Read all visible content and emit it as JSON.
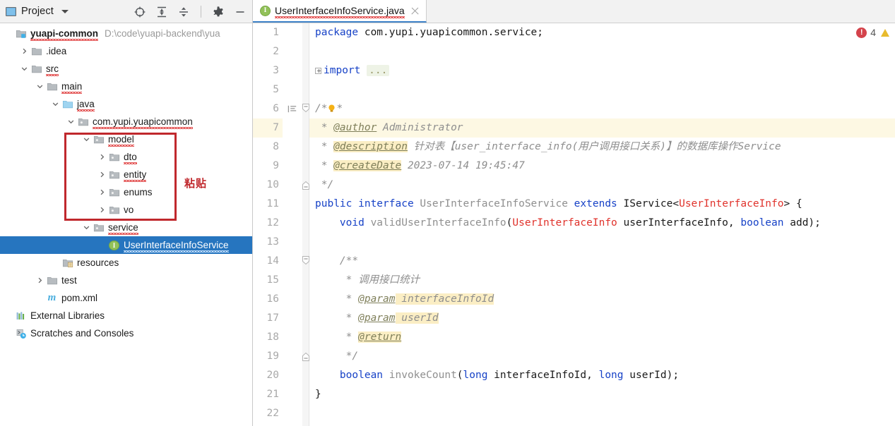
{
  "window": {
    "app": "IntelliJ IDEA"
  },
  "sidebar": {
    "toolbar": {
      "title": "Project",
      "dropdown_icon": "chevron-down-icon",
      "buttons": [
        {
          "name": "select-opened-file-icon",
          "tooltip": "Select Opened File"
        },
        {
          "name": "expand-all-icon",
          "tooltip": "Expand All"
        },
        {
          "name": "collapse-all-icon",
          "tooltip": "Collapse All"
        },
        {
          "name": "settings-gear-icon",
          "tooltip": "Settings"
        },
        {
          "name": "hide-icon",
          "tooltip": "Hide"
        }
      ]
    },
    "tree": [
      {
        "label": "yuapi-common",
        "path": "D:\\code\\yuapi-backend\\yua",
        "icon": "module-folder-icon",
        "indent": 0,
        "arrow": "none",
        "bold": true,
        "spell": true
      },
      {
        "label": ".idea",
        "path": "",
        "icon": "folder-icon",
        "indent": 1,
        "arrow": "collapsed",
        "bold": false,
        "spell": false
      },
      {
        "label": "src",
        "path": "",
        "icon": "folder-icon",
        "indent": 1,
        "arrow": "expanded",
        "bold": false,
        "spell": true
      },
      {
        "label": "main",
        "path": "",
        "icon": "folder-icon",
        "indent": 2,
        "arrow": "expanded",
        "bold": false,
        "spell": true
      },
      {
        "label": "java",
        "path": "",
        "icon": "source-root-folder-icon",
        "indent": 3,
        "arrow": "expanded",
        "bold": false,
        "spell": true
      },
      {
        "label": "com.yupi.yuapicommon",
        "path": "",
        "icon": "package-icon",
        "indent": 4,
        "arrow": "expanded",
        "bold": false,
        "spell": true
      },
      {
        "label": "model",
        "path": "",
        "icon": "package-icon",
        "indent": 5,
        "arrow": "expanded",
        "bold": false,
        "spell": true
      },
      {
        "label": "dto",
        "path": "",
        "icon": "package-icon",
        "indent": 6,
        "arrow": "collapsed",
        "bold": false,
        "spell": true
      },
      {
        "label": "entity",
        "path": "",
        "icon": "package-icon",
        "indent": 6,
        "arrow": "collapsed",
        "bold": false,
        "spell": true
      },
      {
        "label": "enums",
        "path": "",
        "icon": "package-icon",
        "indent": 6,
        "arrow": "collapsed",
        "bold": false,
        "spell": false
      },
      {
        "label": "vo",
        "path": "",
        "icon": "package-icon",
        "indent": 6,
        "arrow": "collapsed",
        "bold": false,
        "spell": false
      },
      {
        "label": "service",
        "path": "",
        "icon": "package-icon",
        "indent": 5,
        "arrow": "expanded",
        "bold": false,
        "spell": true
      },
      {
        "label": "UserInterfaceInfoService",
        "path": "",
        "icon": "java-interface-icon",
        "indent": 6,
        "arrow": "none",
        "bold": false,
        "spell": true,
        "selected": true
      },
      {
        "label": "resources",
        "path": "",
        "icon": "resources-folder-icon",
        "indent": 3,
        "arrow": "none",
        "bold": false,
        "spell": false
      },
      {
        "label": "test",
        "path": "",
        "icon": "folder-icon",
        "indent": 2,
        "arrow": "collapsed",
        "bold": false,
        "spell": false
      },
      {
        "label": "pom.xml",
        "path": "",
        "icon": "maven-pom-icon",
        "indent": 2,
        "arrow": "none",
        "bold": false,
        "spell": false
      },
      {
        "label": "External Libraries",
        "path": "",
        "icon": "external-libraries-icon",
        "indent": 0,
        "arrow": "none",
        "bold": false,
        "spell": false
      },
      {
        "label": "Scratches and Consoles",
        "path": "",
        "icon": "scratches-icon",
        "indent": 0,
        "arrow": "none",
        "bold": false,
        "spell": false
      }
    ],
    "annotation": {
      "label": "粘贴",
      "color": "#c0282d"
    }
  },
  "editor": {
    "tab": {
      "filename": "UserInterfaceInfoService.java",
      "icon": "java-interface-icon",
      "close_icon": "close-icon"
    },
    "inspection": {
      "error_count": "4",
      "error_icon": "error-circle-icon",
      "warning_icon": "warning-triangle-icon"
    },
    "line_numbers": [
      "1",
      "2",
      "3",
      "5",
      "6",
      "7",
      "8",
      "9",
      "10",
      "11",
      "12",
      "13",
      "14",
      "15",
      "16",
      "17",
      "18",
      "19",
      "20",
      "21",
      "22"
    ],
    "highlighted_line": "7",
    "gutter_icons": [
      {
        "line": "6",
        "name": "javadoc-gutter-icon"
      },
      {
        "line": "6",
        "name": "lightbulb-intention-icon"
      }
    ],
    "fold_markers": [
      {
        "line": "3",
        "state": "collapsed"
      },
      {
        "line": "6",
        "state": "expanded-start"
      },
      {
        "line": "10",
        "state": "expanded-end"
      },
      {
        "line": "14",
        "state": "expanded-start"
      },
      {
        "line": "19",
        "state": "expanded-end"
      }
    ],
    "code": [
      {
        "n": "1",
        "tokens": [
          {
            "t": "package ",
            "c": "kw"
          },
          {
            "t": "com.yupi.yuapicommon.service;",
            "c": "plain"
          }
        ]
      },
      {
        "n": "2",
        "tokens": []
      },
      {
        "n": "3",
        "tokens": [
          {
            "t": "FOLDBOX",
            "c": "foldbox"
          },
          {
            "t": "import ",
            "c": "kw"
          },
          {
            "t": "...",
            "c": "folddots"
          }
        ]
      },
      {
        "n": "5",
        "tokens": []
      },
      {
        "n": "6",
        "tokens": [
          {
            "t": "/*",
            "c": "cmt"
          },
          {
            "t": "BULB",
            "c": "bulb"
          },
          {
            "t": "*",
            "c": "cmt"
          }
        ]
      },
      {
        "n": "7",
        "tokens": [
          {
            "t": " * ",
            "c": "cmt"
          },
          {
            "t": "@author",
            "c": "tag"
          },
          {
            "t": " Administrator",
            "c": "cmt"
          }
        ],
        "hl": true
      },
      {
        "n": "8",
        "tokens": [
          {
            "t": " * ",
            "c": "cmt"
          },
          {
            "t": "@description",
            "c": "tag-hl"
          },
          {
            "t": " 针对表【user_interface_info(用户调用接口关系)】的数据库操作Service",
            "c": "cmt"
          }
        ]
      },
      {
        "n": "9",
        "tokens": [
          {
            "t": " * ",
            "c": "cmt"
          },
          {
            "t": "@createDate",
            "c": "tag-hl"
          },
          {
            "t": " 2023-07-14 19:45:47",
            "c": "cmt"
          }
        ]
      },
      {
        "n": "10",
        "tokens": [
          {
            "t": " */",
            "c": "cmt"
          }
        ]
      },
      {
        "n": "11",
        "tokens": [
          {
            "t": "public ",
            "c": "kw"
          },
          {
            "t": "interface ",
            "c": "kw"
          },
          {
            "t": "UserInterfaceInfoService",
            "c": "cls"
          },
          {
            "t": " ",
            "c": "plain"
          },
          {
            "t": "extends",
            "c": "kw"
          },
          {
            "t": " IService<",
            "c": "plain"
          },
          {
            "t": "UserInterfaceInfo",
            "c": "red"
          },
          {
            "t": "> {",
            "c": "plain"
          }
        ]
      },
      {
        "n": "12",
        "tokens": [
          {
            "t": "    ",
            "c": "plain"
          },
          {
            "t": "void",
            "c": "kw"
          },
          {
            "t": " ",
            "c": "plain"
          },
          {
            "t": "validUserInterfaceInfo",
            "c": "cls"
          },
          {
            "t": "(",
            "c": "plain"
          },
          {
            "t": "UserInterfaceInfo",
            "c": "red"
          },
          {
            "t": " userInterfaceInfo, ",
            "c": "plain"
          },
          {
            "t": "boolean",
            "c": "kw"
          },
          {
            "t": " add);",
            "c": "plain"
          }
        ]
      },
      {
        "n": "13",
        "tokens": []
      },
      {
        "n": "14",
        "tokens": [
          {
            "t": "    /**",
            "c": "cmt"
          }
        ]
      },
      {
        "n": "15",
        "tokens": [
          {
            "t": "     * 调用接口统计",
            "c": "cmt"
          }
        ]
      },
      {
        "n": "16",
        "tokens": [
          {
            "t": "     * ",
            "c": "cmt"
          },
          {
            "t": "@param",
            "c": "tag"
          },
          {
            "t": " interfaceInfoId",
            "c": "cmt-hl"
          }
        ]
      },
      {
        "n": "17",
        "tokens": [
          {
            "t": "     * ",
            "c": "cmt"
          },
          {
            "t": "@param",
            "c": "tag"
          },
          {
            "t": " userId",
            "c": "cmt-hl"
          }
        ]
      },
      {
        "n": "18",
        "tokens": [
          {
            "t": "     * ",
            "c": "cmt"
          },
          {
            "t": "@return",
            "c": "tag-hl"
          }
        ]
      },
      {
        "n": "19",
        "tokens": [
          {
            "t": "     */",
            "c": "cmt"
          }
        ]
      },
      {
        "n": "20",
        "tokens": [
          {
            "t": "    ",
            "c": "plain"
          },
          {
            "t": "boolean",
            "c": "kw"
          },
          {
            "t": " ",
            "c": "plain"
          },
          {
            "t": "invokeCount",
            "c": "cls"
          },
          {
            "t": "(",
            "c": "plain"
          },
          {
            "t": "long",
            "c": "kw"
          },
          {
            "t": " interfaceInfoId, ",
            "c": "plain"
          },
          {
            "t": "long",
            "c": "kw"
          },
          {
            "t": " userId);",
            "c": "plain"
          }
        ]
      },
      {
        "n": "21",
        "tokens": [
          {
            "t": "}",
            "c": "plain"
          }
        ]
      },
      {
        "n": "22",
        "tokens": []
      }
    ]
  },
  "colors": {
    "selection_blue": "#2675bf",
    "annotation_red": "#c0282d",
    "keyword_blue": "#1742c7",
    "class_red": "#e0322b",
    "comment_gray": "#8e8e8e",
    "javadoc_tag": "#7f7f5a",
    "highlight_yellow": "#fbeec4",
    "caret_line": "#fdf8e3",
    "error_red": "#d4434b",
    "warning_yellow": "#e8bb2e"
  }
}
